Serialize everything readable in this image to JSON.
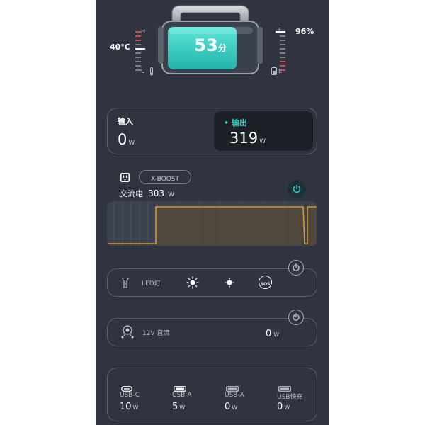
{
  "battery": {
    "percent_text": "53",
    "percent_unit": "分",
    "fill_fraction": 0.53,
    "temperature": "40°C",
    "charge_level": "96%",
    "gauge_hot": "H",
    "gauge_cold": "C",
    "gauge_full": "F",
    "gauge_empty": "E"
  },
  "io": {
    "input_label": "输入",
    "input_value": "0",
    "input_unit": "W",
    "output_label": "• 输出",
    "output_value": "319",
    "output_unit": "W"
  },
  "ac": {
    "boost_label": "X-BOOST",
    "label": "交流电",
    "value": "303",
    "unit": "W"
  },
  "led": {
    "label": "LED灯",
    "sos_label": "SOS"
  },
  "dc": {
    "label": "12V 直流",
    "value": "0",
    "unit": "W"
  },
  "usb": {
    "ports": [
      {
        "name": "USB-C",
        "value": "10",
        "unit": "W"
      },
      {
        "name": "USB-A",
        "value": "5",
        "unit": "W"
      },
      {
        "name": "USB-A",
        "value": "0",
        "unit": "W"
      },
      {
        "name": "USB快充",
        "value": "0",
        "unit": "W"
      }
    ]
  },
  "colors": {
    "accent": "#35c9c0",
    "chart_line": "#d8962a",
    "panel_border": "#596070",
    "background": "#2f3440"
  }
}
